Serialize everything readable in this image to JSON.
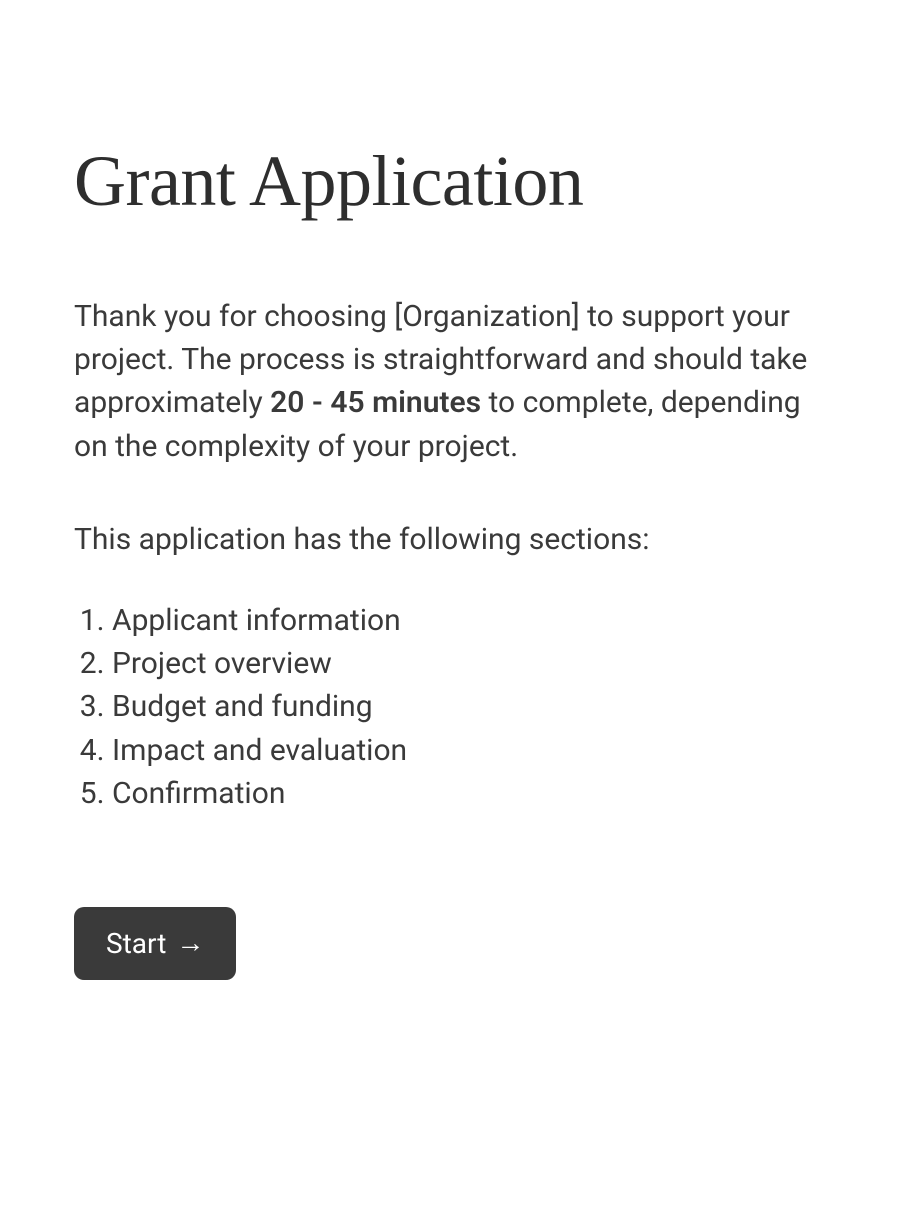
{
  "title": "Grant Application",
  "intro": {
    "before_bold": "Thank you for choosing [Organization] to support your project. The process is straightforward and should take approximately ",
    "bold": "20 - 45 minutes",
    "after_bold": " to complete, depending on the complexity of your project."
  },
  "sections_intro": "This application has the following sections:",
  "sections": [
    "Applicant information",
    "Project overview",
    "Budget and funding",
    "Impact and evaluation",
    "Confirmation"
  ],
  "start_button": {
    "label": "Start",
    "arrow": "→"
  }
}
